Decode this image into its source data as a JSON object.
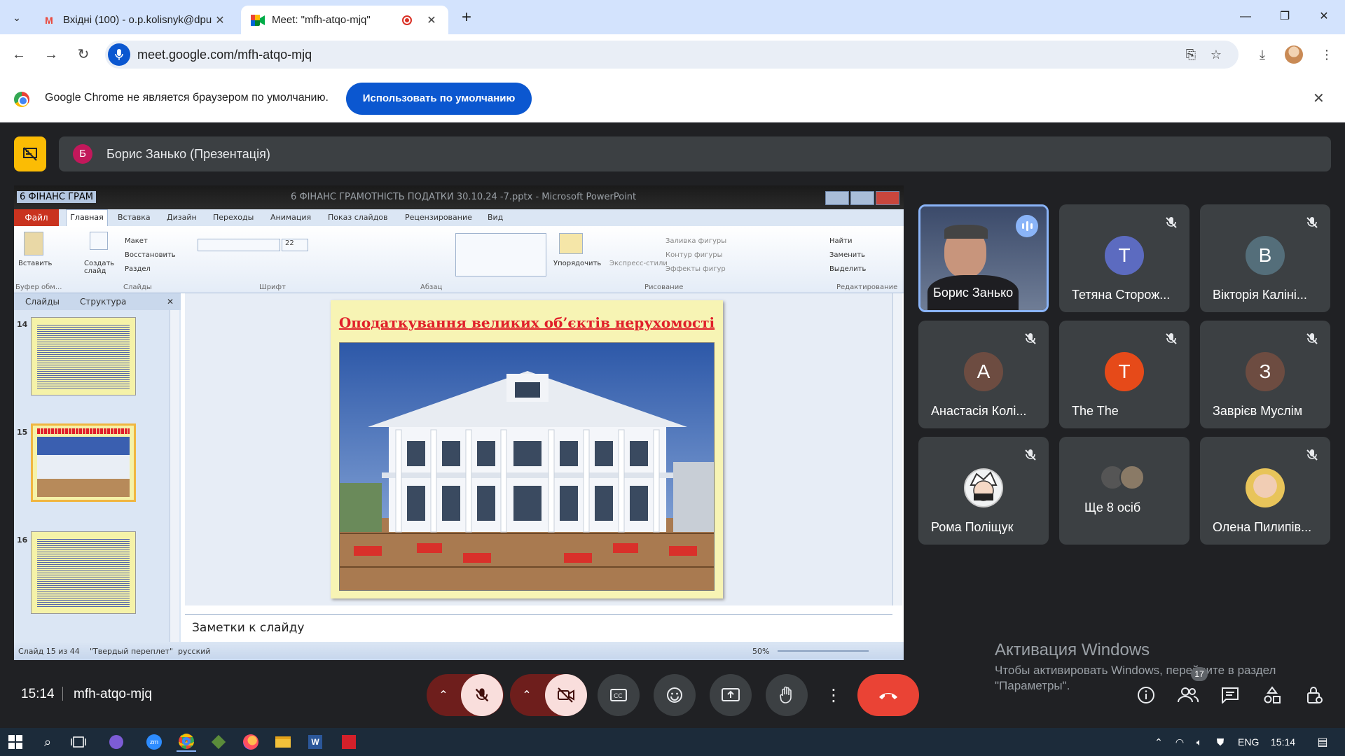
{
  "browser": {
    "tabs": [
      {
        "title": "Вхідні (100) - o.p.kolisnyk@dpu",
        "icon": "gmail-icon",
        "active": false
      },
      {
        "title": "Meet: \"mfh-atqo-mjq\"",
        "icon": "meet-icon",
        "active": true
      }
    ],
    "url": "meet.google.com/mfh-atqo-mjq"
  },
  "infobar": {
    "text": "Google Chrome не является браузером по умолчанию.",
    "button": "Использовать по умолчанию"
  },
  "presentation": {
    "avatar_letter": "Б",
    "presenter": "Борис Занько (Презентація)"
  },
  "powerpoint": {
    "doc_tab": "6 ФІНАНС ГРАМ",
    "window_title": "6 ФІНАНС ГРАМОТНІСТЬ ПОДАТКИ 30.10.24 -7.pptx - Microsoft PowerPoint",
    "file_tab": "Файл",
    "ribbon_tabs": [
      "Главная",
      "Вставка",
      "Дизайн",
      "Переходы",
      "Анимация",
      "Показ слайдов",
      "Рецензирование",
      "Вид"
    ],
    "ribbon": {
      "paste": "Вставить",
      "new_slide": "Создать слайд",
      "layout": "Макет",
      "reset": "Восстановить",
      "section": "Раздел",
      "font_size": "22",
      "arrange": "Упорядочить",
      "quick_styles": "Экспресс-стили",
      "shape_fill": "Заливка фигуры",
      "shape_outline": "Контур фигуры",
      "shape_effects": "Эффекты фигур",
      "find": "Найти",
      "replace": "Заменить",
      "select": "Выделить"
    },
    "groups": [
      "Буфер обм...",
      "Слайды",
      "Шрифт",
      "Абзац",
      "Рисование",
      "Редактирование"
    ],
    "panel_tabs": {
      "slides": "Слайды",
      "outline": "Структура"
    },
    "thumbnails": [
      {
        "num": "14",
        "title": "Задача"
      },
      {
        "num": "15",
        "title": "Оподаткування великих об'єктів нерухомості"
      },
      {
        "num": "16",
        "title": "Оподаткування великих об'єктів нерухомості"
      }
    ],
    "slide_title": "Оподаткування великих об’єктів нерухомості",
    "notes_placeholder": "Заметки к слайду",
    "status": {
      "slide": "Слайд 15 из 44",
      "theme": "\"Твердый переплет\"",
      "lang": "русский",
      "zoom": "50%"
    }
  },
  "participants": [
    {
      "name": "Борис Занько",
      "type": "video",
      "speaking": true
    },
    {
      "name": "Тетяна Сторож...",
      "letter": "Т",
      "color": "#5c6bc0",
      "muted": true
    },
    {
      "name": "Вікторія Каліні...",
      "letter": "В",
      "color": "#546e7a",
      "muted": true
    },
    {
      "name": "Анастасія Колі...",
      "letter": "А",
      "color": "#6d4c41",
      "muted": true
    },
    {
      "name": "The The",
      "letter": "T",
      "color": "#e64a19",
      "muted": true
    },
    {
      "name": "Заврієв Муслім",
      "letter": "З",
      "color": "#6d4c41",
      "muted": true
    },
    {
      "name": "Рома Поліщук",
      "type": "image",
      "muted": true
    },
    {
      "name": "Ще 8 осіб",
      "type": "more"
    },
    {
      "name": "Олена Пилипів...",
      "type": "image",
      "muted": true
    }
  ],
  "windows_activation": {
    "title": "Активация Windows",
    "subtitle": "Чтобы активировать Windows, перейдите в раздел \"Параметры\"."
  },
  "meeting": {
    "time": "15:14",
    "code": "mfh-atqo-mjq",
    "participants_count": "17"
  },
  "taskbar": {
    "lang": "ENG",
    "time": "15:14"
  }
}
